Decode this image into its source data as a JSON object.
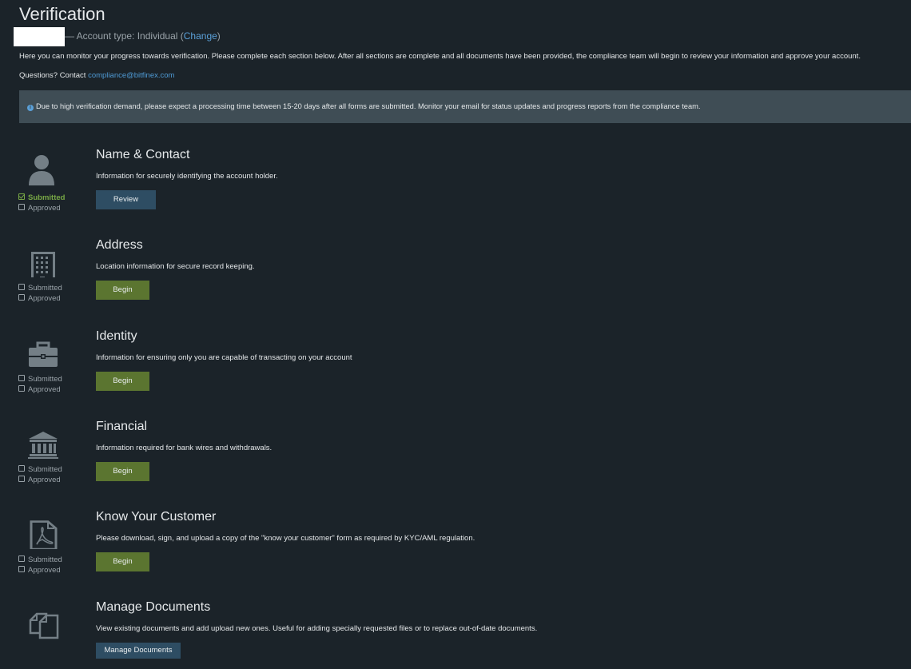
{
  "page": {
    "title": "Verification",
    "account_prefix": "— Account type: Individual (",
    "change_link": "Change",
    "account_suffix": ")",
    "intro": "Here you can monitor your progress towards verification. Please complete each section below. After all sections are complete and all documents have been provided, the compliance team will begin to review your information and approve your account.",
    "questions_label": "Questions? Contact ",
    "contact_email": "compliance@bitfinex.com",
    "notice": "Due to high verification demand, please expect a processing time between 15-20 days after all forms are submitted. Monitor your email for status updates and progress reports from the compliance team."
  },
  "sections": [
    {
      "icon": "person-icon",
      "title": "Name & Contact",
      "description": "Information for securely identifying the account holder.",
      "button": "Review",
      "submitted_label": "Submitted",
      "submitted": true,
      "approved_label": "Approved",
      "approved": false
    },
    {
      "icon": "building-icon",
      "title": "Address",
      "description": "Location information for secure record keeping.",
      "button": "Begin",
      "submitted_label": "Submitted",
      "submitted": false,
      "approved_label": "Approved",
      "approved": false
    },
    {
      "icon": "briefcase-icon",
      "title": "Identity",
      "description": "Information for ensuring only you are capable of transacting on your account",
      "button": "Begin",
      "submitted_label": "Submitted",
      "submitted": false,
      "approved_label": "Approved",
      "approved": false
    },
    {
      "icon": "bank-icon",
      "title": "Financial",
      "description": "Information required for bank wires and withdrawals.",
      "button": "Begin",
      "submitted_label": "Submitted",
      "submitted": false,
      "approved_label": "Approved",
      "approved": false
    },
    {
      "icon": "pdf-file-icon",
      "title": "Know Your Customer",
      "description": "Please download, sign, and upload a copy of the \"know your customer\" form as required by KYC/AML regulation.",
      "button": "Begin",
      "submitted_label": "Submitted",
      "submitted": false,
      "approved_label": "Approved",
      "approved": false
    },
    {
      "icon": "documents-icon",
      "title": "Manage Documents",
      "description": "View existing documents and add upload new ones. Useful for adding specially requested files or to replace out-of-date documents.",
      "button": "Manage Documents"
    }
  ],
  "colors": {
    "background": "#1b2329",
    "notice_bg": "#3f4d55",
    "link": "#5aa0d8",
    "submitted_green": "#77a745",
    "begin_button": "#5b7530",
    "review_button": "#2e4d63",
    "icon_gray": "#747f86"
  }
}
